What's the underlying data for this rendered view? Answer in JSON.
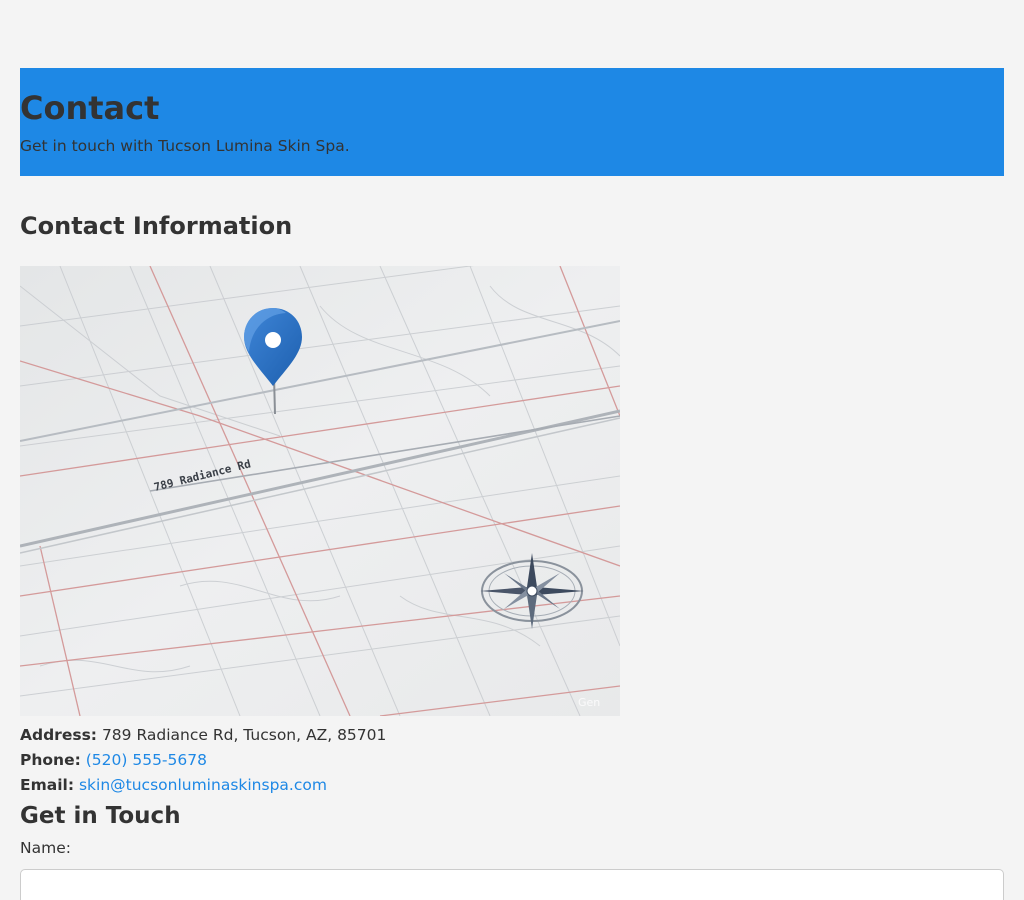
{
  "hero": {
    "title": "Contact",
    "subtitle": "Get in touch with Tucson Lumina Skin Spa."
  },
  "contact_info": {
    "heading": "Contact Information",
    "map": {
      "street_label": "789 Radiance Rd",
      "watermark": "Gen",
      "icons": [
        "location-pin-icon",
        "compass-rose-icon"
      ]
    },
    "address": {
      "label": "Address:",
      "value": "789 Radiance Rd, Tucson, AZ, 85701"
    },
    "phone": {
      "label": "Phone:",
      "value": "(520) 555-5678"
    },
    "email": {
      "label": "Email:",
      "value": "skin@tucsonluminaskinspa.com"
    }
  },
  "form": {
    "heading": "Get in Touch",
    "name_label": "Name:",
    "name_value": ""
  },
  "colors": {
    "accent": "#1e88e5",
    "text": "#333333",
    "background": "#f4f4f4"
  }
}
